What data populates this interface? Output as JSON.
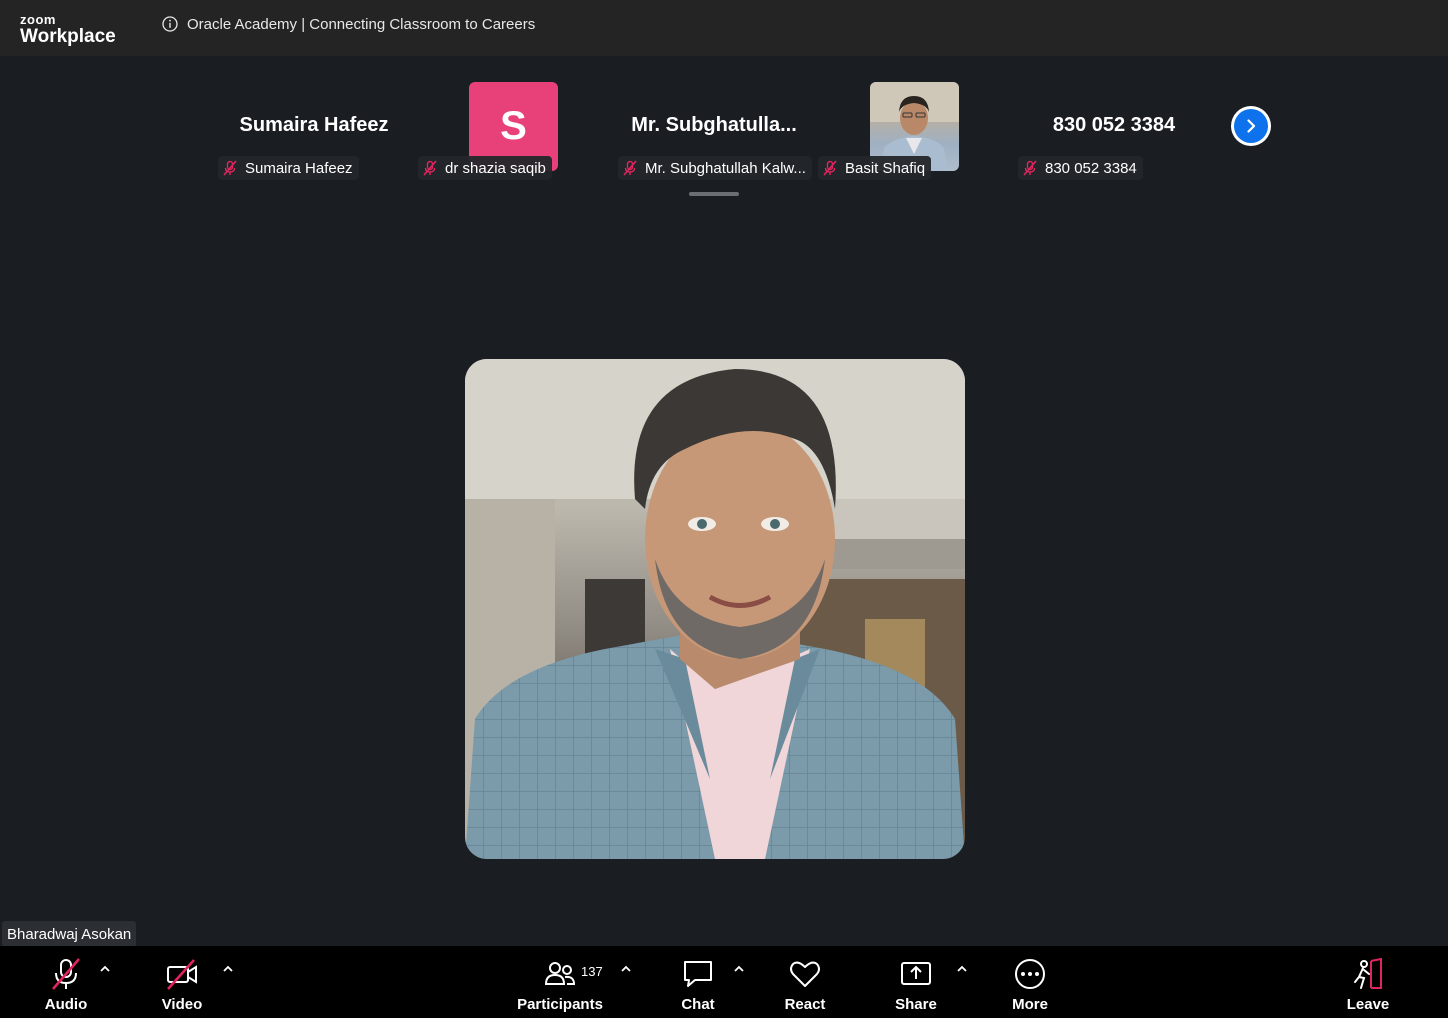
{
  "app": {
    "logo_small": "zoom",
    "logo_large": "Workplace",
    "meeting_title": "Oracle Academy | Connecting Classroom to Careers"
  },
  "strip": {
    "tiles": [
      {
        "display": "Sumaira Hafeez",
        "label": "Sumaira Hafeez"
      },
      {
        "display": "S",
        "label": "dr shazia saqib"
      },
      {
        "display": "Mr.  Subghatulla...",
        "label": "Mr. Subghatullah Kalw..."
      },
      {
        "display": "",
        "label": "Basit Shafiq"
      },
      {
        "display": "830 052 3384",
        "label": "830 052 3384"
      }
    ]
  },
  "speaker": {
    "name": "Bharadwaj Asokan"
  },
  "toolbar": {
    "audio": "Audio",
    "video": "Video",
    "participants": "Participants",
    "participants_count": "137",
    "chat": "Chat",
    "react": "React",
    "share": "Share",
    "more": "More",
    "leave": "Leave"
  },
  "colors": {
    "muted_red": "#e0245e",
    "avatar_pink": "#e8417a",
    "accent_blue": "#0e72ed"
  }
}
